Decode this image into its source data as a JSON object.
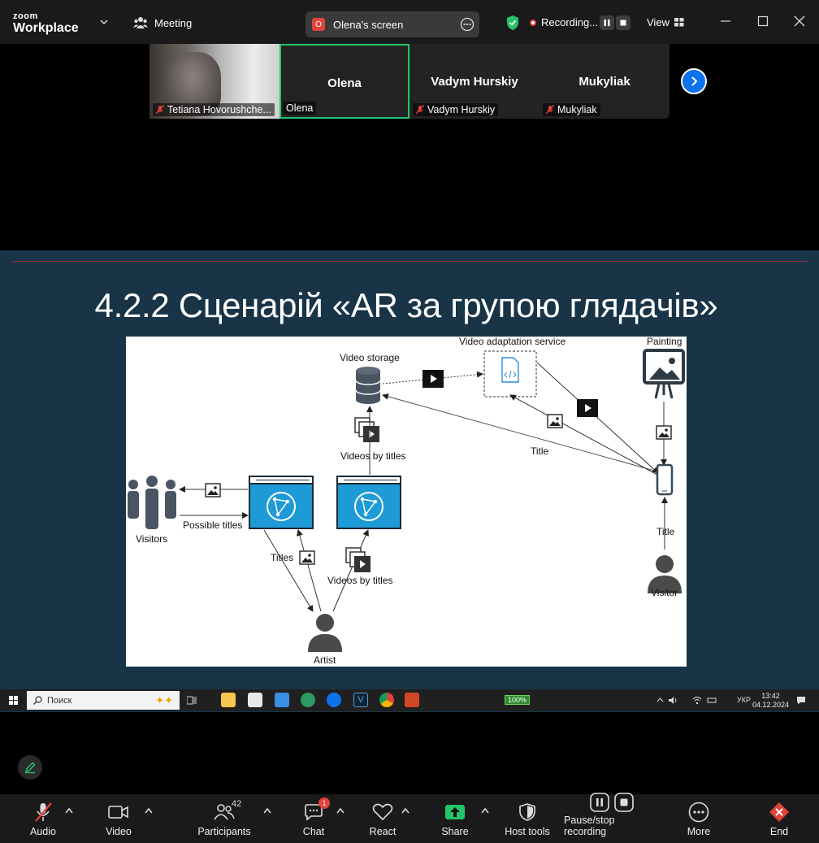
{
  "app": {
    "logo_top": "zoom",
    "logo_bottom": "Workplace",
    "meeting_label": "Meeting",
    "screen_pill": "Olena's screen",
    "screen_badge": "O",
    "recording_label": "Recording...",
    "view_label": "View"
  },
  "gallery": {
    "tiles": [
      {
        "name": "",
        "label": "Tetiana Hovorushche...",
        "muted": true
      },
      {
        "name": "Olena",
        "label": "Olena",
        "muted": false,
        "active": true
      },
      {
        "name": "Vadym Hurskiy",
        "label": "Vadym Hurskiy",
        "muted": true
      },
      {
        "name": "Mukyliak",
        "label": "Mukyliak",
        "muted": true
      }
    ]
  },
  "slide": {
    "title": "4.2.2 Сценарій «AR за групою глядачів»",
    "diagram": {
      "video_storage": "Video storage",
      "video_adaptation_service": "Video adaptation service",
      "painting": "Painting",
      "videos_by_titles_top": "Videos by titles",
      "title_upper": "Title",
      "visitors": "Visitors",
      "possible_titles": "Possible titles",
      "titles": "Titles",
      "videos_by_titles_bottom": "Videos by titles",
      "title_lower": "Title",
      "visitor": "Visitor",
      "artist": "Artist"
    }
  },
  "taskbar": {
    "search_placeholder": "Поиск",
    "battery": "100%",
    "lang": "УКР",
    "time": "13:42",
    "date": "04.12.2024"
  },
  "toolbar": {
    "audio": "Audio",
    "video": "Video",
    "participants": "Participants",
    "participants_count": "42",
    "chat": "Chat",
    "chat_badge": "1",
    "react": "React",
    "share": "Share",
    "host_tools": "Host tools",
    "pause_stop": "Pause/stop recording",
    "more": "More",
    "end": "End"
  },
  "colors": {
    "accent_blue": "#0e72ed",
    "share_green": "#24c46a",
    "end_red": "#e0433b",
    "slide_bg": "#183446",
    "diagram_blue": "#1e9ad6"
  }
}
